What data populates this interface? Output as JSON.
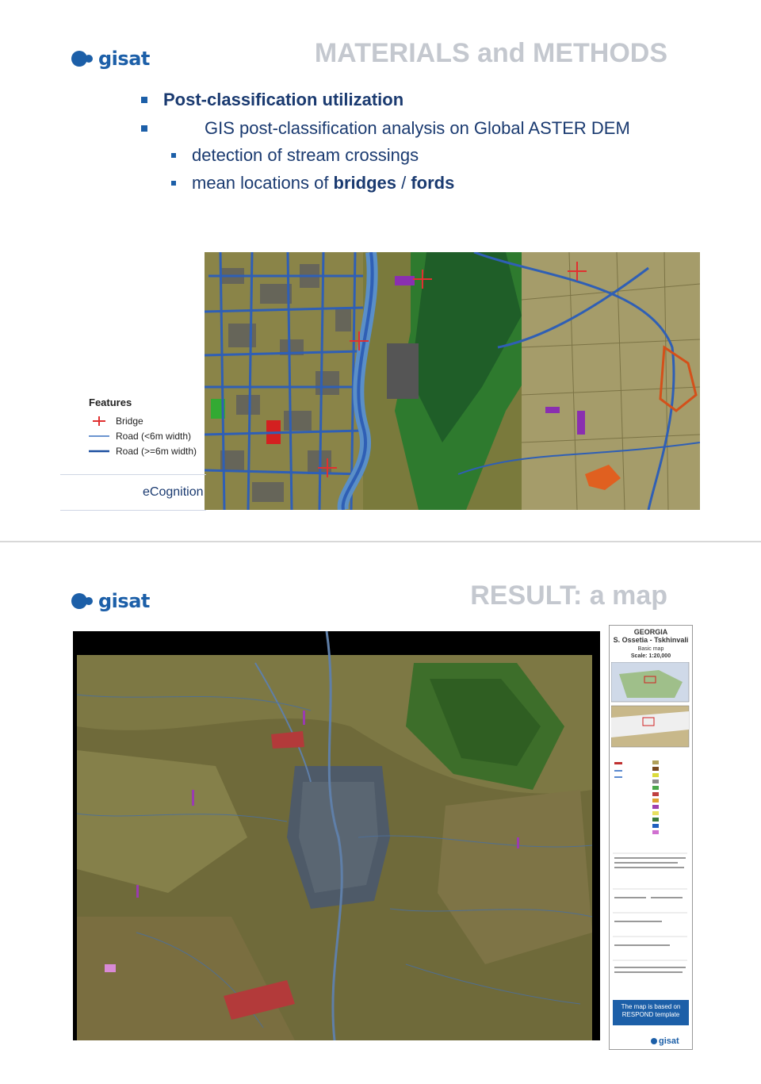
{
  "brand": {
    "logo_text": "gisat",
    "color": "#1c5fa8"
  },
  "slide1": {
    "title": "MATERIALS and METHODS",
    "bullets": [
      {
        "text": "Post-classification utilization",
        "bold": true
      },
      {
        "text": "GIS post-classification analysis on Global ASTER DEM"
      }
    ],
    "sub_bullets": [
      {
        "text": "detection of stream crossings"
      },
      {
        "prefix": "mean locations of ",
        "bold1": "bridges",
        "sep": " / ",
        "bold2": "fords"
      }
    ],
    "legend": {
      "title": "Features",
      "items": [
        {
          "label": "Bridge",
          "symbol": "cross-icon",
          "color": "#e03030"
        },
        {
          "label": "Road (<6m width)",
          "symbol": "thin-line",
          "color": "#3a72c0"
        },
        {
          "label": "Road (>=6m width)",
          "symbol": "thick-line",
          "color": "#1c4fa0"
        }
      ]
    },
    "software_label": "eCognition"
  },
  "slide2": {
    "title": "RESULT: a map",
    "sidebar": {
      "country": "GEORGIA",
      "region": "S. Ossetia - Tskhinvali",
      "map_type": "Basic map",
      "scale": "Scale: 1:20,000",
      "note": "The map is based on RESPOND template",
      "logo_text": "gisat"
    }
  }
}
